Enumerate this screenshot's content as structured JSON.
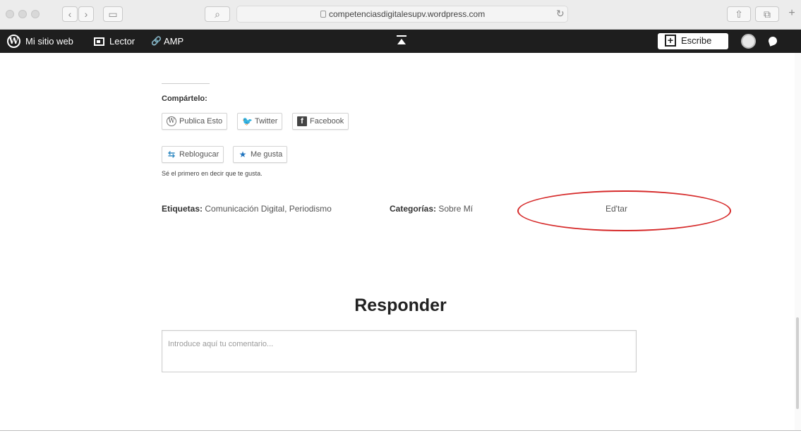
{
  "browser": {
    "url": "competenciasdigitalesupv.wordpress.com",
    "icons": [
      "back-icon",
      "forward-icon",
      "sidebar-icon",
      "search-icon",
      "reader-view-icon",
      "lock-icon",
      "reload-icon",
      "share-icon",
      "tabs-icon",
      "new-tab-icon"
    ]
  },
  "admin_bar": {
    "site_label": "Mi sitio web",
    "reader_label": "Lector",
    "amp_label": "AMP",
    "write_label": "Escribe"
  },
  "share": {
    "title": "Compártelo:",
    "buttons": [
      "Publica Esto",
      "Twitter",
      "Facebook"
    ],
    "reblog_label": "Reblogucar",
    "like_label": "Me gusta",
    "likes_text": "Sé el primero en decir que te gusta."
  },
  "meta": {
    "tags_label": "Etiquetas:",
    "tags_value": "Comunicación Digital, Periodismo",
    "categories_label": "Categorías:",
    "categories_value": "Sobre Mí",
    "edit_label": "Ed'tar",
    "highlight_color": "#d62a2a"
  },
  "reply": {
    "title": "Responder",
    "placeholder": "Introduce aquí tu comentario..."
  }
}
